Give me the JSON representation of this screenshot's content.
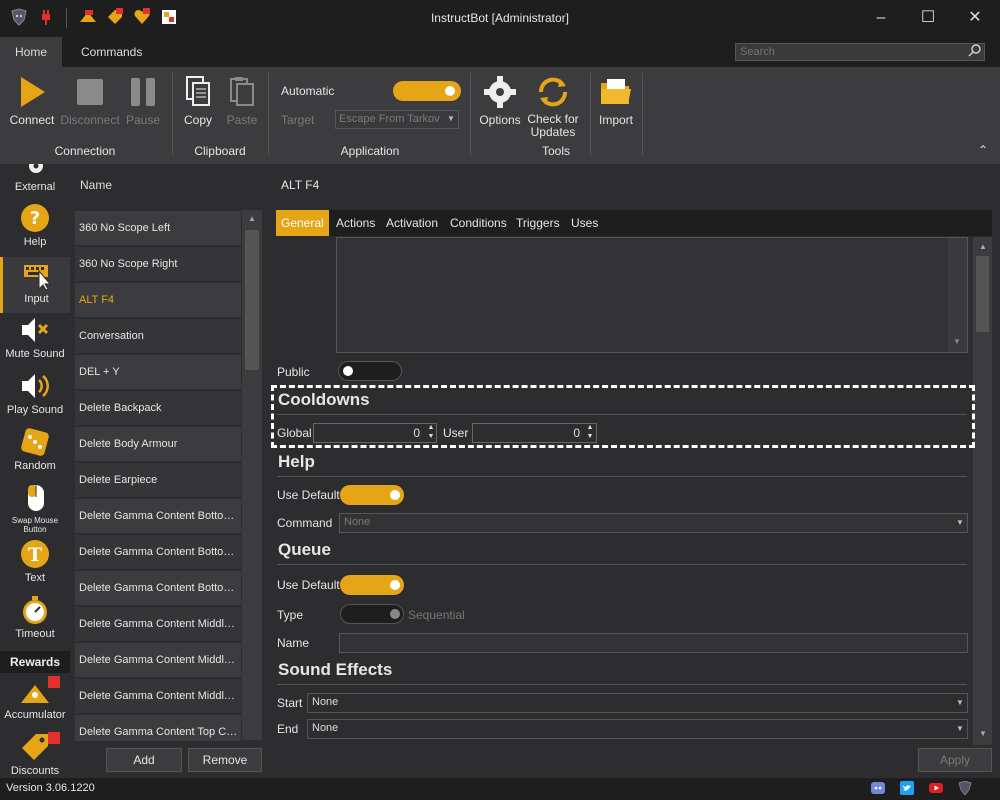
{
  "window": {
    "title": "InstructBot [Administrator]"
  },
  "ribbon_tabs": [
    "Home",
    "Commands"
  ],
  "search": {
    "placeholder": "Search"
  },
  "ribbon": {
    "connect": "Connect",
    "disconnect": "Disconnect",
    "pause": "Pause",
    "group_connection": "Connection",
    "copy": "Copy",
    "paste": "Paste",
    "group_clipboard": "Clipboard",
    "automatic": "Automatic",
    "target": "Target",
    "target_value": "Escape From Tarkov",
    "group_application": "Application",
    "options": "Options",
    "check_updates": "Check for Updates",
    "group_tools": "Tools",
    "import": "Import"
  },
  "nav": {
    "items": [
      "External",
      "Help",
      "Input",
      "Mute Sound",
      "Play Sound",
      "Random",
      "Swap Mouse Button",
      "Text",
      "Timeout"
    ],
    "rewards_header": "Rewards",
    "rewards": [
      "Accumulator",
      "Discounts"
    ]
  },
  "list": {
    "header": "Name",
    "items": [
      "360 No Scope Left",
      "360 No Scope Right",
      "ALT F4",
      "Conversation",
      "DEL + Y",
      "Delete Backpack",
      "Delete Body Armour",
      "Delete Earpiece",
      "Delete Gamma Content Bottom ...",
      "Delete Gamma Content Bottom ...",
      "Delete Gamma Content Bottom ...",
      "Delete Gamma Content Middle ...",
      "Delete Gamma Content Middle L...",
      "Delete Gamma Content Middle ...",
      "Delete Gamma Content Top Ce..."
    ],
    "add": "Add",
    "remove": "Remove"
  },
  "content": {
    "title": "ALT F4",
    "tabs": [
      "General",
      "Actions",
      "Activation",
      "Conditions",
      "Triggers",
      "Uses"
    ],
    "public_label": "Public",
    "cooldowns": {
      "title": "Cooldowns",
      "global_label": "Global",
      "global_value": "0",
      "user_label": "User",
      "user_value": "0"
    },
    "help": {
      "title": "Help",
      "use_default": "Use Default",
      "command_label": "Command",
      "command_value": "None"
    },
    "queue": {
      "title": "Queue",
      "use_default": "Use Default",
      "type_label": "Type",
      "type_value": "Sequential",
      "name_label": "Name"
    },
    "sound": {
      "title": "Sound Effects",
      "start_label": "Start",
      "start_value": "None",
      "end_label": "End",
      "end_value": "None"
    },
    "apply": "Apply"
  },
  "status": {
    "version": "Version 3.06.1220"
  },
  "colors": {
    "accent": "#e6a516",
    "background": "#2d2d30",
    "panel": "#3c3c3f"
  }
}
